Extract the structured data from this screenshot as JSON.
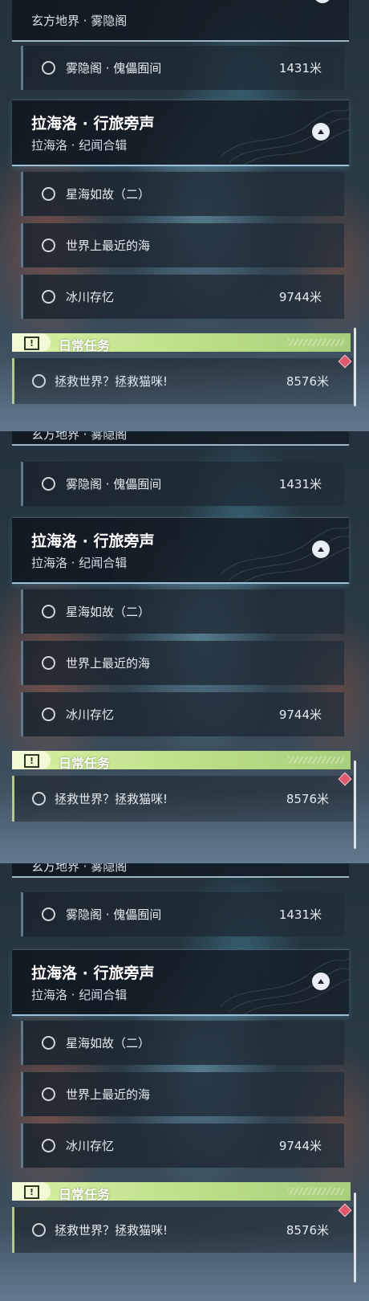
{
  "panels": [
    {
      "top_card": {
        "subtitle": "玄方地界 · 雾隐阁"
      },
      "tasks_before": [
        {
          "label": "雾隐阁 · 傀儡囿间",
          "distance": "1431米"
        }
      ],
      "section": {
        "title": "拉海洛 · 行旅旁声",
        "subtitle": "拉海洛 · 纪闻合辑"
      },
      "tasks_after": [
        {
          "label": "星海如故（二）",
          "distance": ""
        },
        {
          "label": "世界上最近的海",
          "distance": ""
        },
        {
          "label": "冰川存忆",
          "distance": "9744米"
        }
      ],
      "daily": {
        "label": "日常任务",
        "task": {
          "label": "拯救世界？拯救猫咪!",
          "distance": "8576米"
        }
      }
    },
    {
      "top_card": {
        "subtitle": "玄方地界 · 雾隐阁"
      },
      "tasks_before": [
        {
          "label": "雾隐阁 · 傀儡囿间",
          "distance": "1431米"
        }
      ],
      "section": {
        "title": "拉海洛 · 行旅旁声",
        "subtitle": "拉海洛 · 纪闻合辑"
      },
      "tasks_after": [
        {
          "label": "星海如故（二）",
          "distance": ""
        },
        {
          "label": "世界上最近的海",
          "distance": ""
        },
        {
          "label": "冰川存忆",
          "distance": "9744米"
        }
      ],
      "daily": {
        "label": "日常任务",
        "task": {
          "label": "拯救世界？拯救猫咪!",
          "distance": "8576米"
        }
      }
    },
    {
      "top_card": {
        "subtitle": "玄方地界 · 雾隐阁"
      },
      "tasks_before": [
        {
          "label": "雾隐阁 · 傀儡囿间",
          "distance": "1431米"
        }
      ],
      "section": {
        "title": "拉海洛 · 行旅旁声",
        "subtitle": "拉海洛 · 纪闻合辑"
      },
      "tasks_after": [
        {
          "label": "星海如故（二）",
          "distance": ""
        },
        {
          "label": "世界上最近的海",
          "distance": ""
        },
        {
          "label": "冰川存忆",
          "distance": "9744米"
        }
      ],
      "daily": {
        "label": "日常任务",
        "task": {
          "label": "拯救世界？拯救猫咪!",
          "distance": "8576米"
        }
      }
    }
  ],
  "icons": {
    "collapse": "chevron-up-icon",
    "status": "circle-outline-icon",
    "daily": "exclamation-box-icon",
    "tracking": "diamond-marker-icon"
  },
  "colors": {
    "daily_bar": "#b9dd86",
    "header_border": "#9ec0d8",
    "tracking_marker": "#e0566b"
  }
}
